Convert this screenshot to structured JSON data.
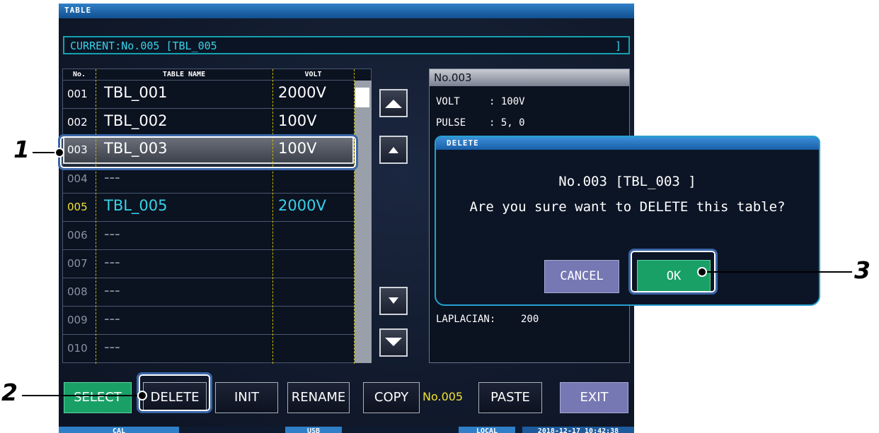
{
  "window": {
    "title": "TABLE"
  },
  "current": {
    "label": "CURRENT:No.005 [TBL_005",
    "end": "]"
  },
  "table": {
    "headers": {
      "no": "No.",
      "name": "TABLE NAME",
      "volt": "VOLT"
    },
    "rows": [
      {
        "no": "001",
        "name": "TBL_001",
        "volt": "2000V"
      },
      {
        "no": "002",
        "name": "TBL_002",
        "volt": "100V"
      },
      {
        "no": "003",
        "name": "TBL_003",
        "volt": "100V"
      },
      {
        "no": "004",
        "name": "---",
        "volt": ""
      },
      {
        "no": "005",
        "name": "TBL_005",
        "volt": "2000V"
      },
      {
        "no": "006",
        "name": "---",
        "volt": ""
      },
      {
        "no": "007",
        "name": "---",
        "volt": ""
      },
      {
        "no": "008",
        "name": "---",
        "volt": ""
      },
      {
        "no": "009",
        "name": "---",
        "volt": ""
      },
      {
        "no": "010",
        "name": "---",
        "volt": ""
      }
    ]
  },
  "detail": {
    "header": "No.003",
    "volt_label": "VOLT",
    "volt_value": ": 100V",
    "pulse_label": "PULSE",
    "pulse_value": ":  5,  0",
    "laplacian_label": "LAPLACIAN:",
    "laplacian_value": "200"
  },
  "dialog": {
    "title": "DELETE",
    "line1": "No.003 [TBL_003         ]",
    "line2": "Are you sure want to DELETE this table?",
    "cancel": "CANCEL",
    "ok": "OK"
  },
  "buttons": {
    "select": "SELECT",
    "delete": "DELETE",
    "init": "INIT",
    "rename": "RENAME",
    "copy": "COPY",
    "clipboard_no": "No.005",
    "paste": "PASTE",
    "exit": "EXIT"
  },
  "status": {
    "cal": "CAL",
    "usb": "USB",
    "local": "LOCAL",
    "datetime": "2018-12-17 10:42:38"
  },
  "callouts": {
    "c1": "1",
    "c2": "2",
    "c3": "3"
  },
  "colors": {
    "accent": "#37d2e8",
    "ok": "#19a066",
    "cancel": "#7678b4",
    "title_bar": "#2f7fc8",
    "callout_frame": "#3a66a8"
  }
}
